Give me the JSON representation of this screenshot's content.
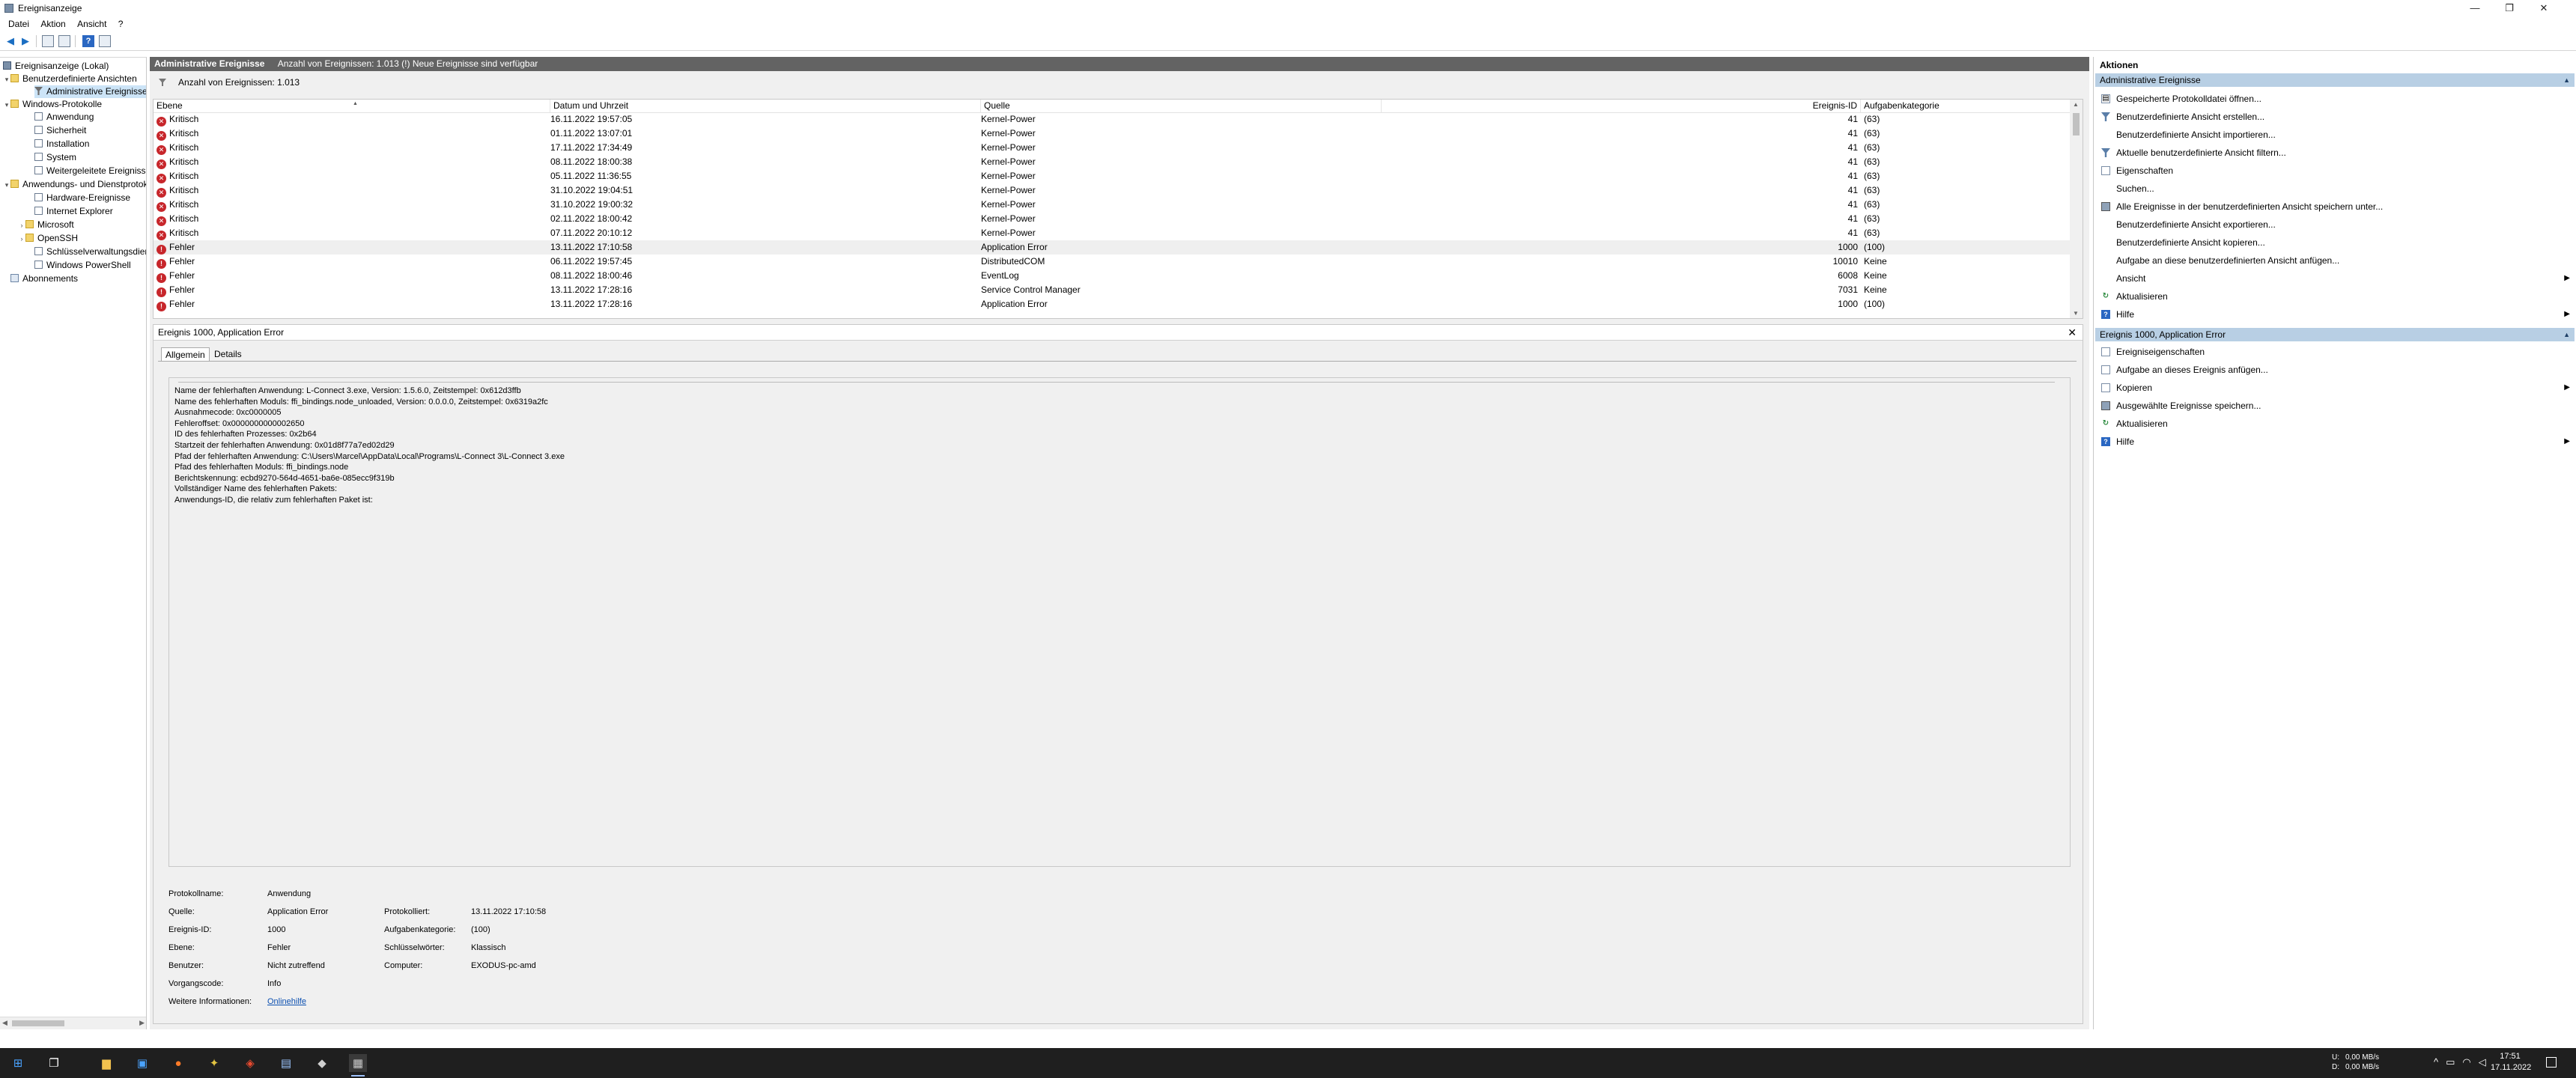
{
  "window": {
    "title": "Ereignisanzeige"
  },
  "window_controls": {
    "minimize": "—",
    "maximize": "❐",
    "close": "✕"
  },
  "menu": [
    "Datei",
    "Aktion",
    "Ansicht",
    "?"
  ],
  "tree": {
    "root": "Ereignisanzeige (Lokal)",
    "custom_views": "Benutzerdefinierte Ansichten",
    "admin_events": "Administrative Ereignisse",
    "windows_logs": "Windows-Protokolle",
    "application": "Anwendung",
    "security": "Sicherheit",
    "setup": "Installation",
    "system": "System",
    "forwarded": "Weitergeleitete Ereignisse",
    "app_service_logs": "Anwendungs- und Dienstprotokolle",
    "hardware": "Hardware-Ereignisse",
    "ie": "Internet Explorer",
    "microsoft": "Microsoft",
    "openssh": "OpenSSH",
    "key_mgmt": "Schlüsselverwaltungsdienst",
    "powershell": "Windows PowerShell",
    "subscriptions": "Abonnements"
  },
  "center": {
    "header_title": "Administrative Ereignisse",
    "header_info": "Anzahl von Ereignissen: 1.013 (!) Neue Ereignisse sind verfügbar",
    "filter_text": "Anzahl von Ereignissen: 1.013",
    "columns": {
      "level": "Ebene",
      "datetime": "Datum und Uhrzeit",
      "source": "Quelle",
      "event_id": "Ereignis-ID",
      "category": "Aufgabenkategorie"
    },
    "rows": [
      {
        "level": "Kritisch",
        "date": "16.11.2022 19:57:05",
        "source": "Kernel-Power",
        "id": "41",
        "cat": "(63)"
      },
      {
        "level": "Kritisch",
        "date": "01.11.2022 13:07:01",
        "source": "Kernel-Power",
        "id": "41",
        "cat": "(63)"
      },
      {
        "level": "Kritisch",
        "date": "17.11.2022 17:34:49",
        "source": "Kernel-Power",
        "id": "41",
        "cat": "(63)"
      },
      {
        "level": "Kritisch",
        "date": "08.11.2022 18:00:38",
        "source": "Kernel-Power",
        "id": "41",
        "cat": "(63)"
      },
      {
        "level": "Kritisch",
        "date": "05.11.2022 11:36:55",
        "source": "Kernel-Power",
        "id": "41",
        "cat": "(63)"
      },
      {
        "level": "Kritisch",
        "date": "31.10.2022 19:04:51",
        "source": "Kernel-Power",
        "id": "41",
        "cat": "(63)"
      },
      {
        "level": "Kritisch",
        "date": "31.10.2022 19:00:32",
        "source": "Kernel-Power",
        "id": "41",
        "cat": "(63)"
      },
      {
        "level": "Kritisch",
        "date": "02.11.2022 18:00:42",
        "source": "Kernel-Power",
        "id": "41",
        "cat": "(63)"
      },
      {
        "level": "Kritisch",
        "date": "07.11.2022 20:10:12",
        "source": "Kernel-Power",
        "id": "41",
        "cat": "(63)"
      },
      {
        "level": "Fehler",
        "date": "13.11.2022 17:10:58",
        "source": "Application Error",
        "id": "1000",
        "cat": "(100)"
      },
      {
        "level": "Fehler",
        "date": "06.11.2022 19:57:45",
        "source": "DistributedCOM",
        "id": "10010",
        "cat": "Keine"
      },
      {
        "level": "Fehler",
        "date": "08.11.2022 18:00:46",
        "source": "EventLog",
        "id": "6008",
        "cat": "Keine"
      },
      {
        "level": "Fehler",
        "date": "13.11.2022 17:28:16",
        "source": "Service Control Manager",
        "id": "7031",
        "cat": "Keine"
      },
      {
        "level": "Fehler",
        "date": "13.11.2022 17:28:16",
        "source": "Application Error",
        "id": "1000",
        "cat": "(100)"
      }
    ]
  },
  "detail": {
    "title": "Ereignis 1000, Application Error",
    "tabs": {
      "general": "Allgemein",
      "details": "Details"
    },
    "message_lines": [
      "Name der fehlerhaften Anwendung: L-Connect 3.exe, Version: 1.5.6.0, Zeitstempel: 0x612d3ffb",
      "Name des fehlerhaften Moduls: ffi_bindings.node_unloaded, Version: 0.0.0.0, Zeitstempel: 0x6319a2fc",
      "Ausnahmecode: 0xc0000005",
      "Fehleroffset: 0x0000000000002650",
      "ID des fehlerhaften Prozesses: 0x2b64",
      "Startzeit der fehlerhaften Anwendung: 0x01d8f77a7ed02d29",
      "Pfad der fehlerhaften Anwendung: C:\\Users\\Marcel\\AppData\\Local\\Programs\\L-Connect 3\\L-Connect 3.exe",
      "Pfad des fehlerhaften Moduls: ffi_bindings.node",
      "Berichtskennung: ecbd9270-564d-4651-ba6e-085ecc9f319b",
      "Vollständiger Name des fehlerhaften Pakets:",
      "Anwendungs-ID, die relativ zum fehlerhaften Paket ist:"
    ],
    "props": {
      "log_name_label": "Protokollname:",
      "log_name": "Anwendung",
      "source_label": "Quelle:",
      "source": "Application Error",
      "logged_label": "Protokolliert:",
      "logged": "13.11.2022 17:10:58",
      "event_id_label": "Ereignis-ID:",
      "event_id": "1000",
      "task_cat_label": "Aufgabenkategorie:",
      "task_cat": "(100)",
      "level_label": "Ebene:",
      "level": "Fehler",
      "keywords_label": "Schlüsselwörter:",
      "keywords": "Klassisch",
      "user_label": "Benutzer:",
      "user": "Nicht zutreffend",
      "computer_label": "Computer:",
      "computer": "EXODUS-pc-amd",
      "opcode_label": "Vorgangscode:",
      "opcode": "Info",
      "more_info_label": "Weitere Informationen:",
      "more_info": "Onlinehilfe"
    }
  },
  "actions": {
    "title": "Aktionen",
    "section1": "Administrative Ereignisse",
    "section1_items": [
      {
        "label": "Gespeicherte Protokolldatei öffnen...",
        "icon": "open-folder-icon"
      },
      {
        "label": "Benutzerdefinierte Ansicht erstellen...",
        "icon": "filter-icon"
      },
      {
        "label": "Benutzerdefinierte Ansicht importieren...",
        "icon": ""
      },
      {
        "label": "Aktuelle benutzerdefinierte Ansicht filtern...",
        "icon": "filter-icon"
      },
      {
        "label": "Eigenschaften",
        "icon": "properties-icon"
      },
      {
        "label": "Suchen...",
        "icon": "find-icon"
      },
      {
        "label": "Alle Ereignisse in der benutzerdefinierten Ansicht speichern unter...",
        "icon": "save-icon"
      },
      {
        "label": "Benutzerdefinierte Ansicht exportieren...",
        "icon": ""
      },
      {
        "label": "Benutzerdefinierte Ansicht kopieren...",
        "icon": ""
      },
      {
        "label": "Aufgabe an diese benutzerdefinierten Ansicht anfügen...",
        "icon": ""
      },
      {
        "label": "Ansicht",
        "icon": ""
      },
      {
        "label": "Aktualisieren",
        "icon": "refresh-icon"
      },
      {
        "label": "Hilfe",
        "icon": "help-icon"
      }
    ],
    "section2": "Ereignis 1000, Application Error",
    "section2_items": [
      {
        "label": "Ereigniseigenschaften",
        "icon": "properties-icon"
      },
      {
        "label": "Aufgabe an dieses Ereignis anfügen...",
        "icon": "task-icon"
      },
      {
        "label": "Kopieren",
        "icon": "copy-icon"
      },
      {
        "label": "Ausgewählte Ereignisse speichern...",
        "icon": "save-icon"
      },
      {
        "label": "Aktualisieren",
        "icon": "refresh-icon"
      },
      {
        "label": "Hilfe",
        "icon": "help-icon"
      }
    ]
  },
  "taskbar": {
    "net_up_label": "U:",
    "net_up": "0,00 MB/s",
    "net_down_label": "D:",
    "net_down": "0,00 MB/s",
    "time": "17:51",
    "date": "17.11.2022"
  }
}
